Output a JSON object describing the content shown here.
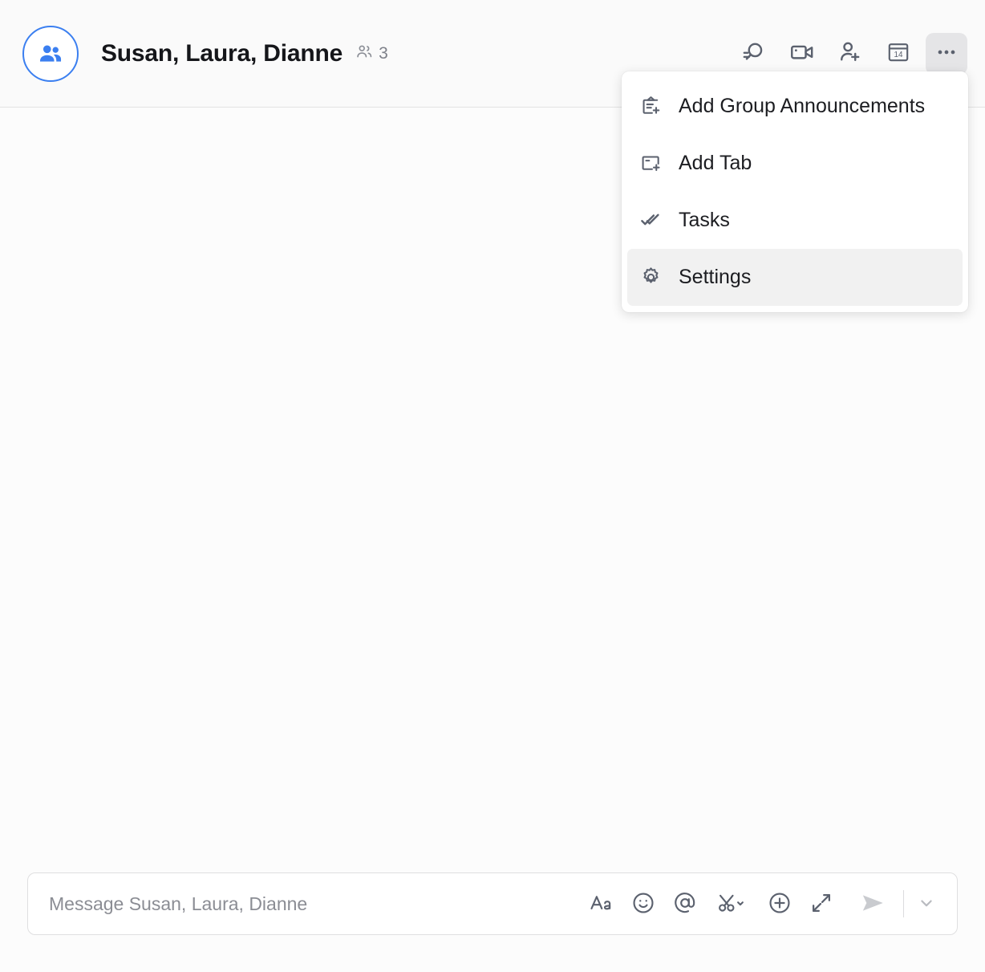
{
  "header": {
    "avatar_icon": "group-people-icon",
    "title": "Susan, Laura, Dianne",
    "roster_icon": "people-roster-icon",
    "member_count": "3",
    "actions": [
      {
        "name": "search-icon",
        "label": "Search"
      },
      {
        "name": "video-camera-icon",
        "label": "Meet now"
      },
      {
        "name": "add-person-icon",
        "label": "Add people"
      },
      {
        "name": "calendar-icon",
        "label": "Schedule",
        "day": "14"
      },
      {
        "name": "more-options-icon",
        "label": "More options"
      }
    ]
  },
  "menu": {
    "items": [
      {
        "icon": "announcement-add-icon",
        "label": "Add Group Announcements",
        "selected": false
      },
      {
        "icon": "tab-add-icon",
        "label": "Add Tab",
        "selected": false
      },
      {
        "icon": "double-check-icon",
        "label": "Tasks",
        "selected": false
      },
      {
        "icon": "gear-icon",
        "label": "Settings",
        "selected": true
      }
    ]
  },
  "composer": {
    "placeholder": "Message Susan, Laura, Dianne",
    "value": "",
    "tools": [
      {
        "name": "format-text-icon",
        "label": "Format"
      },
      {
        "name": "emoji-icon",
        "label": "Emoji"
      },
      {
        "name": "mention-icon",
        "label": "Mention"
      },
      {
        "name": "snip-scissors-icon",
        "label": "Snip"
      },
      {
        "name": "add-attachment-icon",
        "label": "More options"
      },
      {
        "name": "expand-icon",
        "label": "Expand compose box"
      }
    ],
    "send_label": "Send",
    "send_options_label": "Send options"
  },
  "colors": {
    "accent_blue": "#3b7ff0",
    "icon_gray": "#5b616e",
    "text_primary": "#15161a",
    "text_muted": "#7e818a",
    "surface": "#fcfcfc",
    "menu_selected": "#f1f1f1",
    "send_disabled": "#c9cbcf"
  }
}
